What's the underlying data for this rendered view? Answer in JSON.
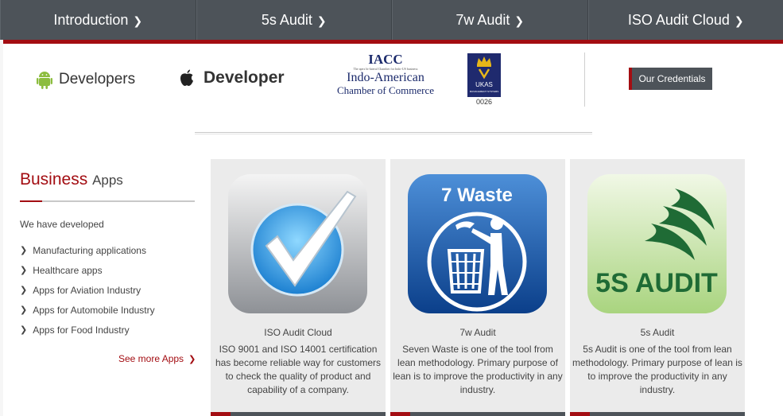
{
  "nav": {
    "items": [
      {
        "label": "Introduction"
      },
      {
        "label": "5s Audit"
      },
      {
        "label": "7w Audit"
      },
      {
        "label": "ISO Audit Cloud"
      }
    ]
  },
  "logos": {
    "android_label": "Developers",
    "apple_label": "Developer",
    "iacc_title": "IACC",
    "iacc_tagline": "The apex bi-lateral Chamber for Indo-US business",
    "iacc_line1": "Indo-American",
    "iacc_line2": "Chamber of Commerce",
    "ukas_text": "UKAS",
    "ukas_sub": "MANAGEMENT SYSTEMS",
    "ukas_number": "0026"
  },
  "credentials_label": "Our Credentials",
  "sidebar": {
    "title_main": "Business",
    "title_sub": "Apps",
    "intro": "We have developed",
    "items": [
      {
        "label": "Manufacturing applications"
      },
      {
        "label": "Healthcare apps"
      },
      {
        "label": "Apps for Aviation Industry"
      },
      {
        "label": "Apps for Automobile Industry"
      },
      {
        "label": "Apps for Food Industry"
      }
    ],
    "see_more": "See more Apps"
  },
  "cards": [
    {
      "name": "ISO Audit Cloud",
      "desc": "ISO 9001 and ISO 14001 certification has become reliable way for customers to check the quality of product and capability of a company."
    },
    {
      "name": "7w Audit",
      "icon_text": "7 Waste",
      "desc": "Seven Waste is one of the tool from lean methodology. Primary purpose of lean is to improve the productivity in any industry."
    },
    {
      "name": "5s Audit",
      "icon_text": "5S AUDIT",
      "desc": "5s Audit is one of the tool from lean methodology. Primary purpose of lean is to improve the productivity in any industry."
    }
  ],
  "colors": {
    "accent": "#a30d12",
    "nav_bg": "#4d5359",
    "card_bg": "#ebebeb"
  }
}
